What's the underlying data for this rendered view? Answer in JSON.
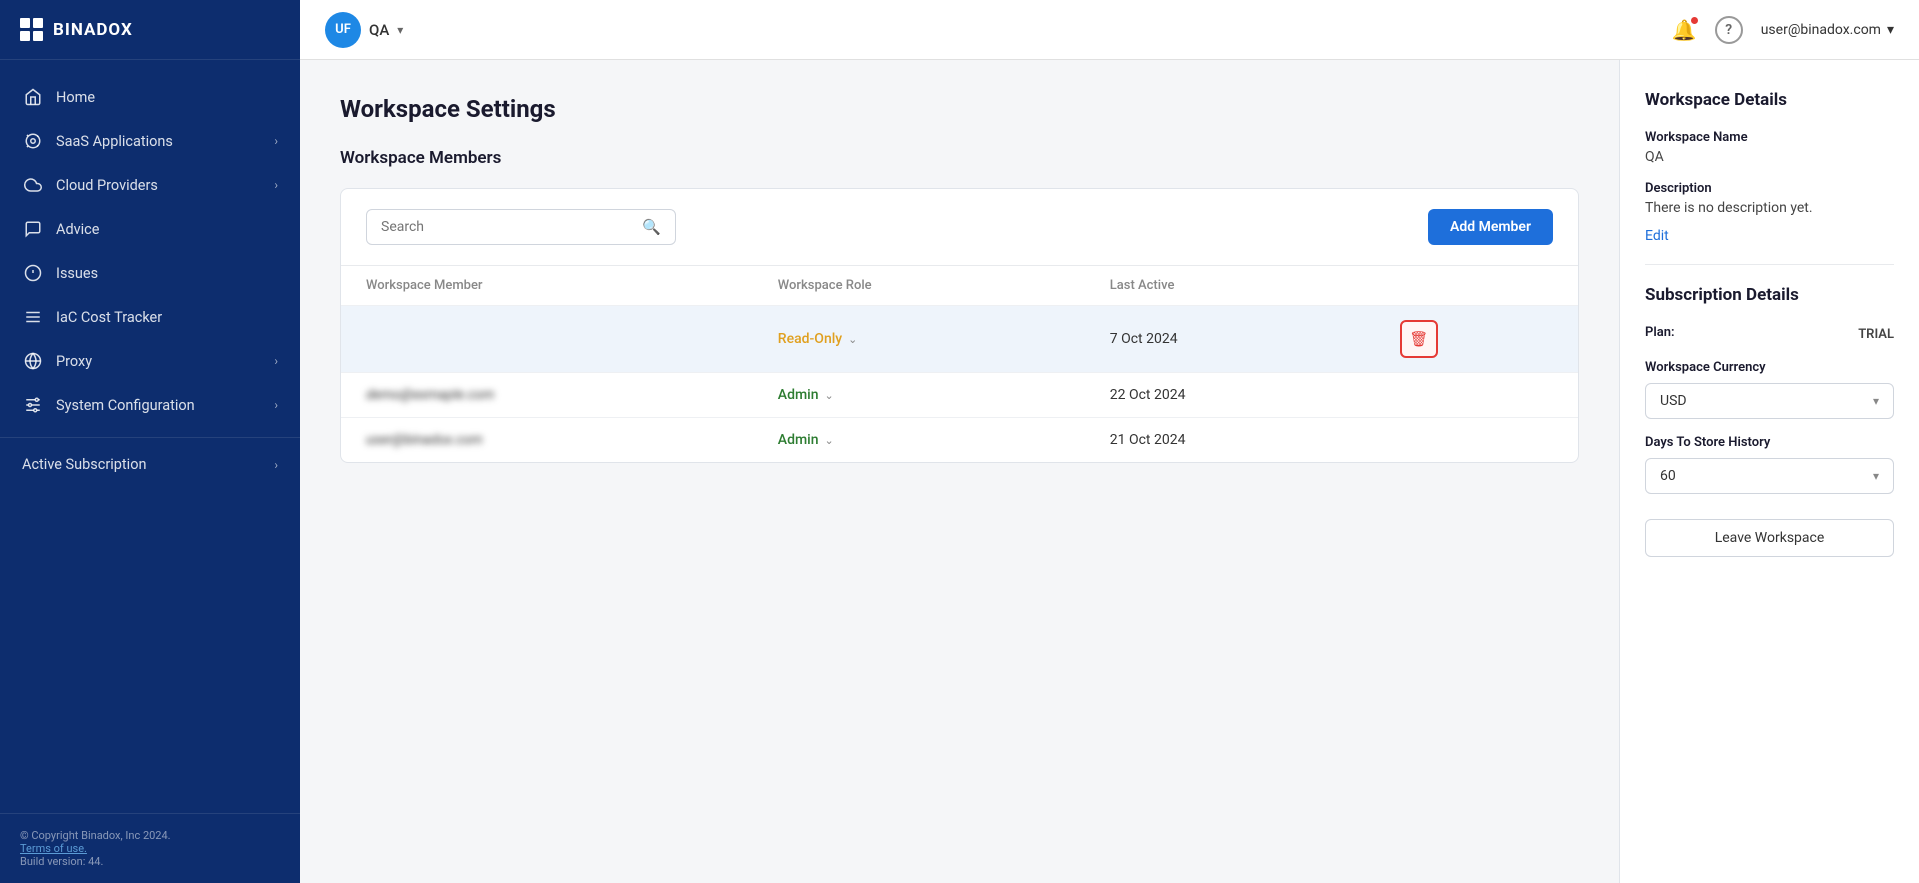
{
  "logo": {
    "text": "BINADOX"
  },
  "sidebar": {
    "items": [
      {
        "id": "home",
        "label": "Home",
        "icon": "home-icon",
        "has_chevron": false
      },
      {
        "id": "saas",
        "label": "SaaS Applications",
        "icon": "saas-icon",
        "has_chevron": true
      },
      {
        "id": "cloud",
        "label": "Cloud Providers",
        "icon": "cloud-icon",
        "has_chevron": true
      },
      {
        "id": "advice",
        "label": "Advice",
        "icon": "advice-icon",
        "has_chevron": false
      },
      {
        "id": "issues",
        "label": "Issues",
        "icon": "issues-icon",
        "has_chevron": false
      },
      {
        "id": "iac",
        "label": "IaC Cost Tracker",
        "icon": "iac-icon",
        "has_chevron": false
      },
      {
        "id": "proxy",
        "label": "Proxy",
        "icon": "proxy-icon",
        "has_chevron": true
      },
      {
        "id": "sysconfg",
        "label": "System Configuration",
        "icon": "sysconfig-icon",
        "has_chevron": true
      }
    ],
    "active_subscription": {
      "label": "Active Subscription",
      "has_chevron": true
    },
    "footer": {
      "copyright": "© Copyright Binadox, Inc 2024.",
      "terms_label": "Terms of use.",
      "build": "Build version: 44."
    }
  },
  "topbar": {
    "workspace_avatar": "UF",
    "workspace_name": "QA",
    "user_email": "user@binadox.com"
  },
  "main": {
    "page_title": "Workspace Settings",
    "members_section_title": "Workspace Members",
    "search_placeholder": "Search",
    "add_member_button": "Add Member",
    "table": {
      "columns": [
        "Workspace Member",
        "Workspace Role",
        "Last Active"
      ],
      "rows": [
        {
          "email": "",
          "email_display": "",
          "role": "Read-Only",
          "role_type": "readonly",
          "last_active": "7 Oct 2024",
          "highlighted": true,
          "show_delete": true
        },
        {
          "email": "demo@example.com",
          "email_display": "demo@example.com",
          "role": "Admin",
          "role_type": "admin",
          "last_active": "22 Oct 2024",
          "highlighted": false,
          "show_delete": false
        },
        {
          "email": "user@binadox.com",
          "email_display": "user@binadox.com",
          "role": "Admin",
          "role_type": "admin",
          "last_active": "21 Oct 2024",
          "highlighted": false,
          "show_delete": false
        }
      ]
    }
  },
  "right_panel": {
    "workspace_details_title": "Workspace Details",
    "workspace_name_label": "Workspace Name",
    "workspace_name_value": "QA",
    "description_label": "Description",
    "description_value": "There is no description yet.",
    "edit_label": "Edit",
    "subscription_title": "Subscription Details",
    "plan_label": "Plan:",
    "plan_value": "TRIAL",
    "currency_title": "Workspace Currency",
    "currency_value": "USD",
    "history_title": "Days To Store History",
    "history_value": "60",
    "leave_workspace_label": "Leave Workspace"
  }
}
